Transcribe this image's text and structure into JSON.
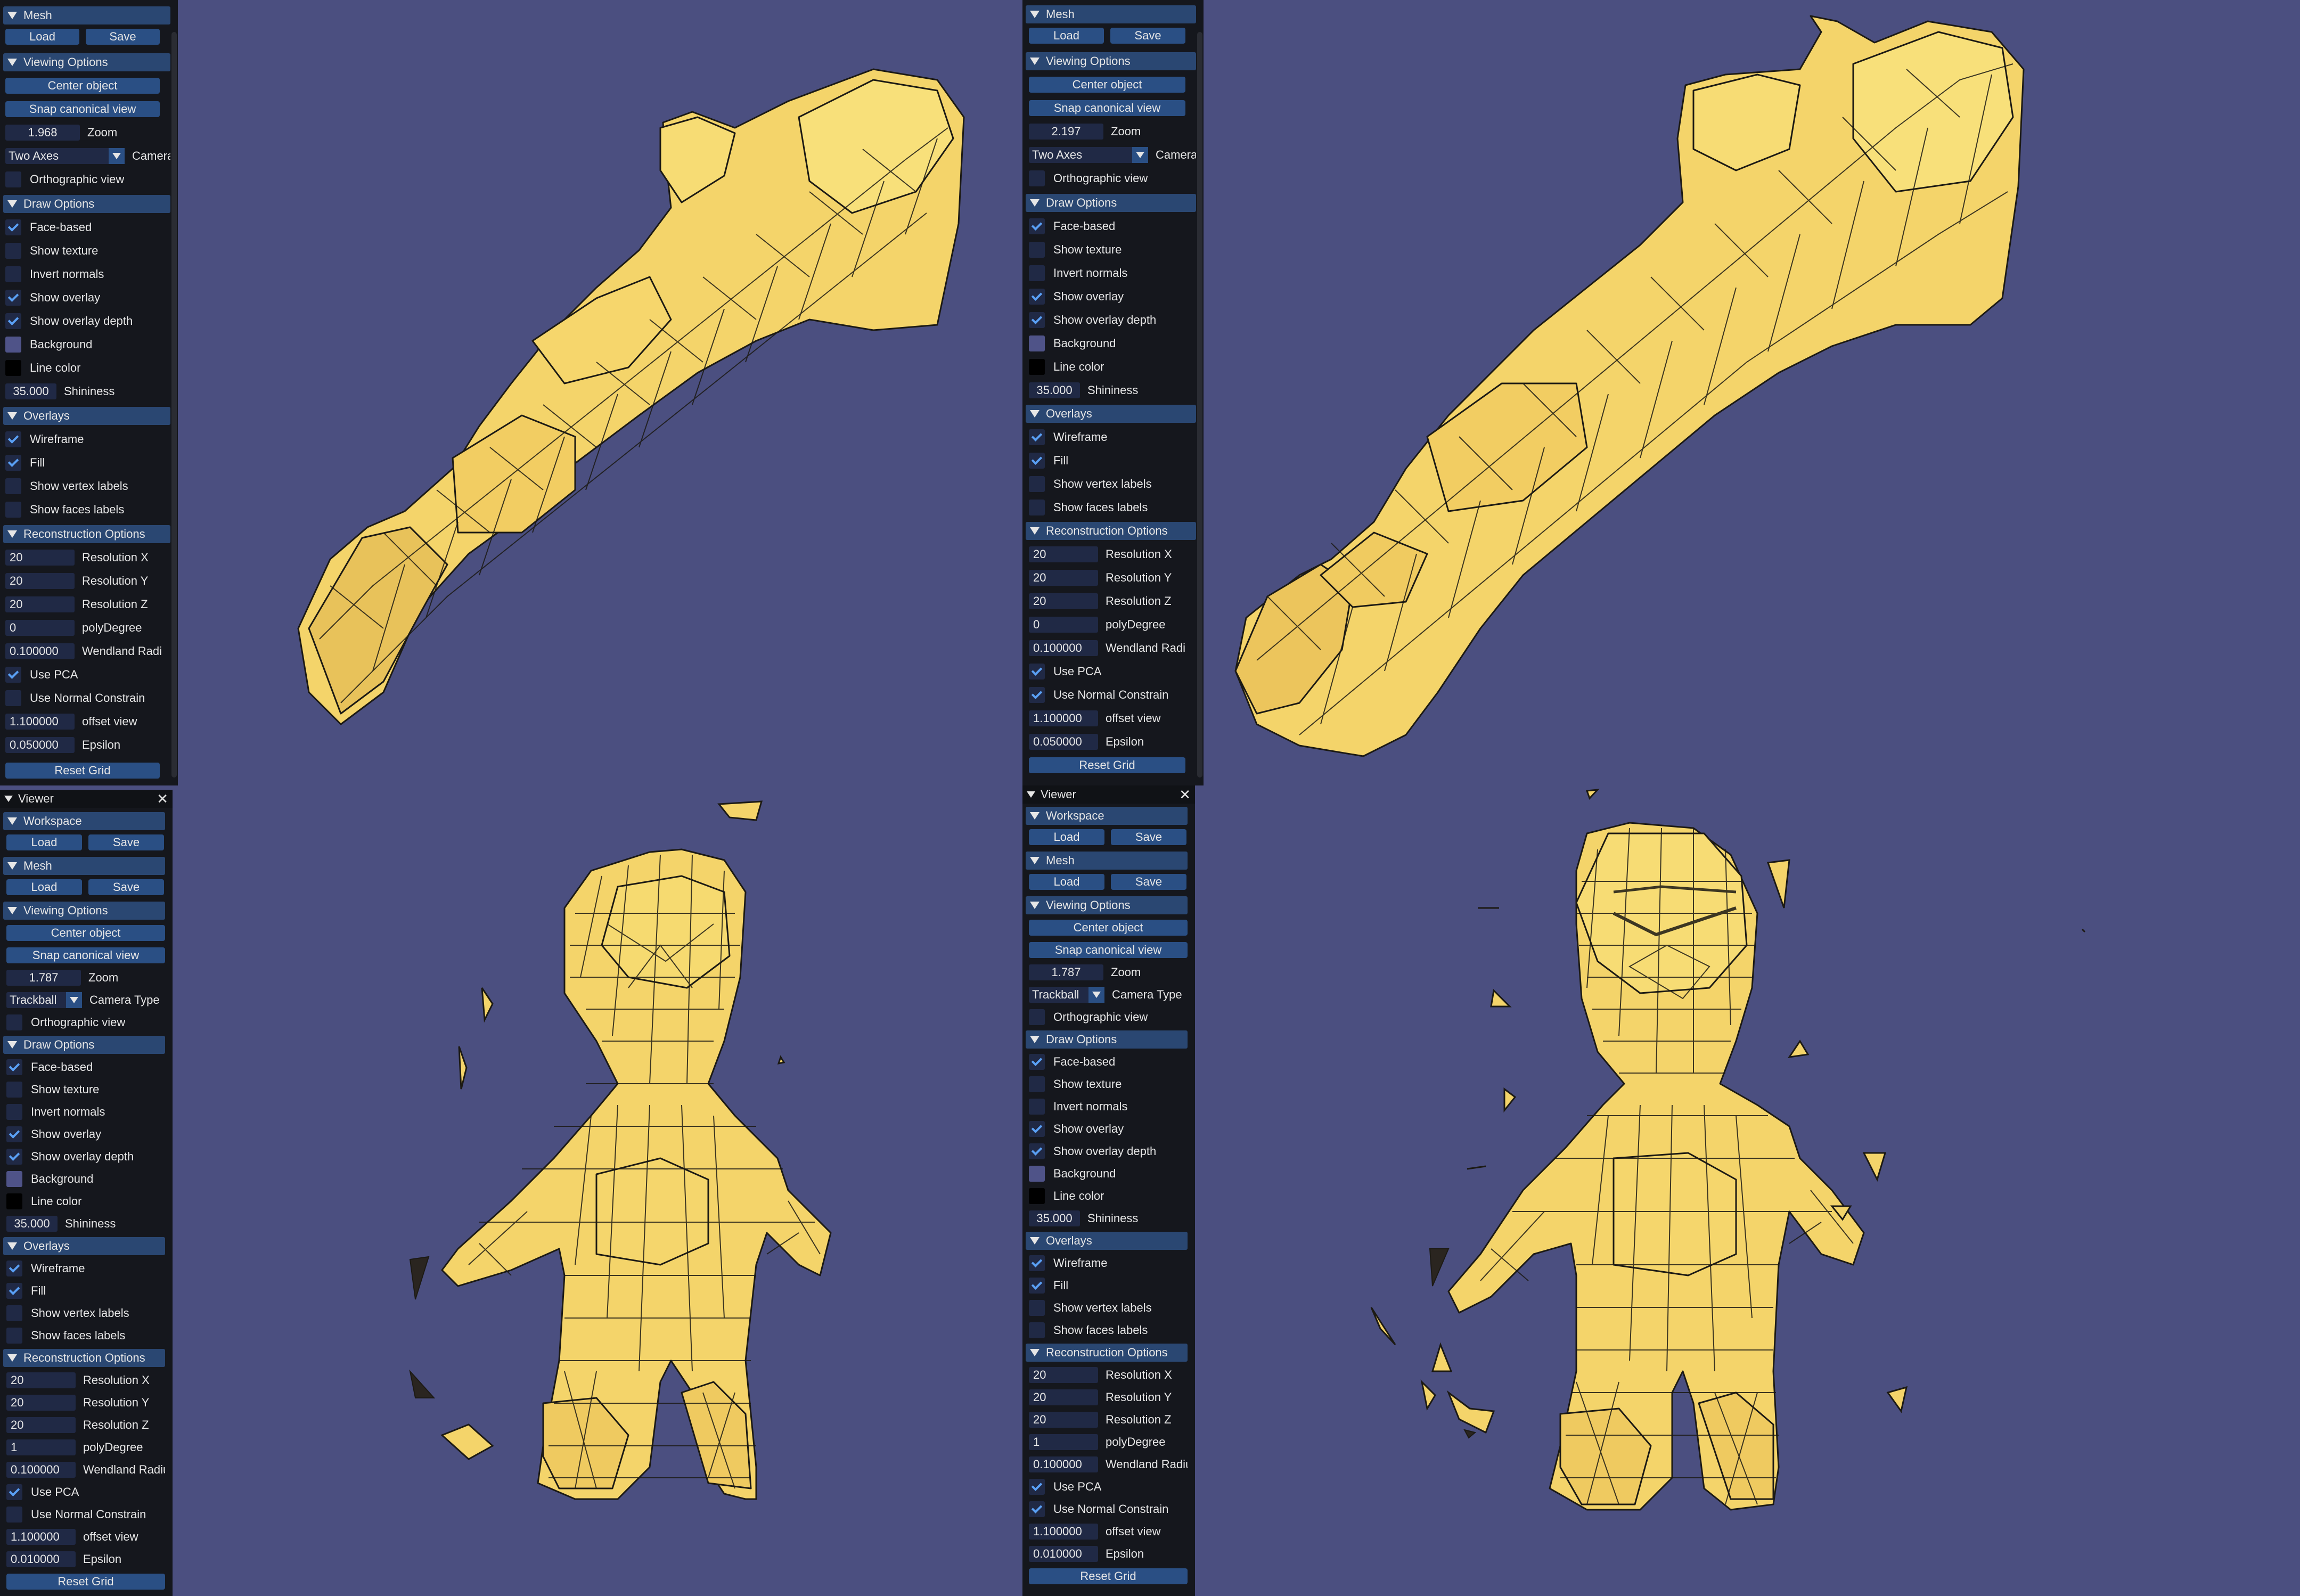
{
  "colors": {
    "background": "#4b4f80",
    "mesh_fill": "#f4d46a",
    "wire": "#1c1a14",
    "panel": "#15171d",
    "header": "#2a4772",
    "button": "#2a4f84",
    "frame": "#202945",
    "check": "#5aa0f5",
    "background_swatch": "#4f5388",
    "line_swatch": "#000000"
  },
  "panels": [
    {
      "window_title": "",
      "has_workspace": false,
      "mesh": {
        "header": "Mesh",
        "load": "Load",
        "save": "Save"
      },
      "viewing": {
        "header": "Viewing Options",
        "center": "Center object",
        "snap": "Snap canonical view",
        "zoom_value": "1.968",
        "zoom_label": "Zoom",
        "camera_value": "Two Axes",
        "camera_label": "Camera Type",
        "ortho": {
          "label": "Orthographic view",
          "checked": false
        }
      },
      "draw": {
        "header": "Draw Options",
        "items": [
          {
            "label": "Face-based",
            "checked": true
          },
          {
            "label": "Show texture",
            "checked": false
          },
          {
            "label": "Invert normals",
            "checked": false
          },
          {
            "label": "Show overlay",
            "checked": true
          },
          {
            "label": "Show overlay depth",
            "checked": true
          }
        ],
        "background": "Background",
        "line_color": "Line color",
        "shininess_value": "35.000",
        "shininess_label": "Shininess"
      },
      "overlays": {
        "header": "Overlays",
        "items": [
          {
            "label": "Wireframe",
            "checked": true
          },
          {
            "label": "Fill",
            "checked": true
          },
          {
            "label": "Show vertex labels",
            "checked": false
          },
          {
            "label": "Show faces labels",
            "checked": false
          }
        ]
      },
      "recon": {
        "header": "Reconstruction Options",
        "fields": [
          {
            "value": "20",
            "label": "Resolution X"
          },
          {
            "value": "20",
            "label": "Resolution Y"
          },
          {
            "value": "20",
            "label": "Resolution Z"
          },
          {
            "value": "0",
            "label": "polyDegree"
          },
          {
            "value": "0.100000",
            "label": "Wendland Radi"
          }
        ],
        "use_pca": {
          "label": "Use PCA",
          "checked": true
        },
        "use_normal": {
          "label": "Use Normal Constrain",
          "checked": false
        },
        "offset": {
          "value": "1.100000",
          "label": "offset view"
        },
        "epsilon": {
          "value": "0.050000",
          "label": "Epsilon"
        },
        "reset": "Reset Grid"
      }
    },
    {
      "window_title": "",
      "has_workspace": false,
      "mesh": {
        "header": "Mesh",
        "load": "Load",
        "save": "Save"
      },
      "viewing": {
        "header": "Viewing Options",
        "center": "Center object",
        "snap": "Snap canonical view",
        "zoom_value": "2.197",
        "zoom_label": "Zoom",
        "camera_value": "Two Axes",
        "camera_label": "Camera Type",
        "ortho": {
          "label": "Orthographic view",
          "checked": false
        }
      },
      "draw": {
        "header": "Draw Options",
        "items": [
          {
            "label": "Face-based",
            "checked": true
          },
          {
            "label": "Show texture",
            "checked": false
          },
          {
            "label": "Invert normals",
            "checked": false
          },
          {
            "label": "Show overlay",
            "checked": true
          },
          {
            "label": "Show overlay depth",
            "checked": true
          }
        ],
        "background": "Background",
        "line_color": "Line color",
        "shininess_value": "35.000",
        "shininess_label": "Shininess"
      },
      "overlays": {
        "header": "Overlays",
        "items": [
          {
            "label": "Wireframe",
            "checked": true
          },
          {
            "label": "Fill",
            "checked": true
          },
          {
            "label": "Show vertex labels",
            "checked": false
          },
          {
            "label": "Show faces labels",
            "checked": false
          }
        ]
      },
      "recon": {
        "header": "Reconstruction Options",
        "fields": [
          {
            "value": "20",
            "label": "Resolution X"
          },
          {
            "value": "20",
            "label": "Resolution Y"
          },
          {
            "value": "20",
            "label": "Resolution Z"
          },
          {
            "value": "0",
            "label": "polyDegree"
          },
          {
            "value": "0.100000",
            "label": "Wendland Radi"
          }
        ],
        "use_pca": {
          "label": "Use PCA",
          "checked": true
        },
        "use_normal": {
          "label": "Use Normal Constrain",
          "checked": true
        },
        "offset": {
          "value": "1.100000",
          "label": "offset view"
        },
        "epsilon": {
          "value": "0.050000",
          "label": "Epsilon"
        },
        "reset": "Reset Grid"
      }
    },
    {
      "window_title": "Viewer",
      "has_workspace": true,
      "workspace": {
        "header": "Workspace",
        "load": "Load",
        "save": "Save"
      },
      "mesh": {
        "header": "Mesh",
        "load": "Load",
        "save": "Save"
      },
      "viewing": {
        "header": "Viewing Options",
        "center": "Center object",
        "snap": "Snap canonical view",
        "zoom_value": "1.787",
        "zoom_label": "Zoom",
        "camera_value": "Trackball",
        "camera_label": "Camera Type",
        "ortho": {
          "label": "Orthographic view",
          "checked": false
        }
      },
      "draw": {
        "header": "Draw Options",
        "items": [
          {
            "label": "Face-based",
            "checked": true
          },
          {
            "label": "Show texture",
            "checked": false
          },
          {
            "label": "Invert normals",
            "checked": false
          },
          {
            "label": "Show overlay",
            "checked": true
          },
          {
            "label": "Show overlay depth",
            "checked": true
          }
        ],
        "background": "Background",
        "line_color": "Line color",
        "shininess_value": "35.000",
        "shininess_label": "Shininess"
      },
      "overlays": {
        "header": "Overlays",
        "items": [
          {
            "label": "Wireframe",
            "checked": true
          },
          {
            "label": "Fill",
            "checked": true
          },
          {
            "label": "Show vertex labels",
            "checked": false
          },
          {
            "label": "Show faces labels",
            "checked": false
          }
        ]
      },
      "recon": {
        "header": "Reconstruction Options",
        "fields": [
          {
            "value": "20",
            "label": "Resolution X"
          },
          {
            "value": "20",
            "label": "Resolution Y"
          },
          {
            "value": "20",
            "label": "Resolution Z"
          },
          {
            "value": "1",
            "label": "polyDegree"
          },
          {
            "value": "0.100000",
            "label": "Wendland Radius I"
          }
        ],
        "use_pca": {
          "label": "Use PCA",
          "checked": true
        },
        "use_normal": {
          "label": "Use Normal Constrain",
          "checked": false
        },
        "offset": {
          "value": "1.100000",
          "label": "offset view"
        },
        "epsilon": {
          "value": "0.010000",
          "label": "Epsilon"
        },
        "reset": "Reset Grid"
      }
    },
    {
      "window_title": "Viewer",
      "has_workspace": true,
      "workspace": {
        "header": "Workspace",
        "load": "Load",
        "save": "Save"
      },
      "mesh": {
        "header": "Mesh",
        "load": "Load",
        "save": "Save"
      },
      "viewing": {
        "header": "Viewing Options",
        "center": "Center object",
        "snap": "Snap canonical view",
        "zoom_value": "1.787",
        "zoom_label": "Zoom",
        "camera_value": "Trackball",
        "camera_label": "Camera Type",
        "ortho": {
          "label": "Orthographic view",
          "checked": false
        }
      },
      "draw": {
        "header": "Draw Options",
        "items": [
          {
            "label": "Face-based",
            "checked": true
          },
          {
            "label": "Show texture",
            "checked": false
          },
          {
            "label": "Invert normals",
            "checked": false
          },
          {
            "label": "Show overlay",
            "checked": true
          },
          {
            "label": "Show overlay depth",
            "checked": true
          }
        ],
        "background": "Background",
        "line_color": "Line color",
        "shininess_value": "35.000",
        "shininess_label": "Shininess"
      },
      "overlays": {
        "header": "Overlays",
        "items": [
          {
            "label": "Wireframe",
            "checked": true
          },
          {
            "label": "Fill",
            "checked": true
          },
          {
            "label": "Show vertex labels",
            "checked": false
          },
          {
            "label": "Show faces labels",
            "checked": false
          }
        ]
      },
      "recon": {
        "header": "Reconstruction Options",
        "fields": [
          {
            "value": "20",
            "label": "Resolution X"
          },
          {
            "value": "20",
            "label": "Resolution Y"
          },
          {
            "value": "20",
            "label": "Resolution Z"
          },
          {
            "value": "1",
            "label": "polyDegree"
          },
          {
            "value": "0.100000",
            "label": "Wendland Radius I"
          }
        ],
        "use_pca": {
          "label": "Use PCA",
          "checked": true
        },
        "use_normal": {
          "label": "Use Normal Constrain",
          "checked": true
        },
        "offset": {
          "value": "1.100000",
          "label": "offset view"
        },
        "epsilon": {
          "value": "0.010000",
          "label": "Epsilon"
        },
        "reset": "Reset Grid"
      }
    }
  ]
}
